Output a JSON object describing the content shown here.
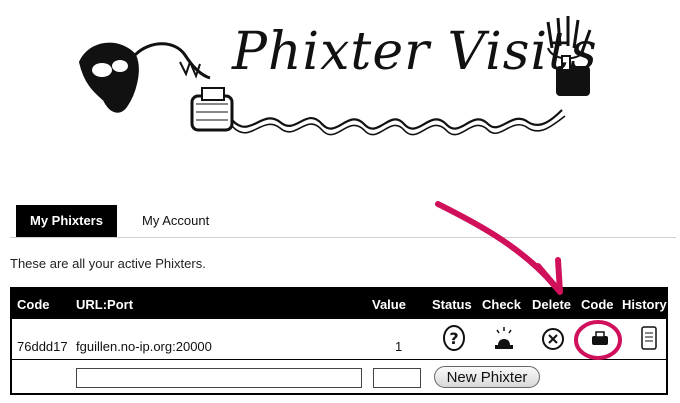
{
  "logo": {
    "title": "Phixter Visits"
  },
  "tabs": [
    {
      "label": "My Phixters",
      "active": true
    },
    {
      "label": "My Account",
      "active": false
    }
  ],
  "intro": "These are all your active Phixters.",
  "table": {
    "headers": [
      "Code",
      "URL:Port",
      "Value",
      "Status",
      "Check",
      "Delete",
      "Code",
      "History"
    ],
    "rows": [
      {
        "code": "76ddd17",
        "url": "fguillen.no-ip.org:20000",
        "value": "1",
        "icons": [
          "question-icon",
          "siren-icon",
          "delete-x-icon",
          "phone-code-icon",
          "history-doc-icon"
        ]
      }
    ]
  },
  "add_form": {
    "url_value": "",
    "value_value": "",
    "button_label": "New Phixter"
  },
  "annotation": {
    "color": "#d0105a",
    "highlights": "Code"
  }
}
